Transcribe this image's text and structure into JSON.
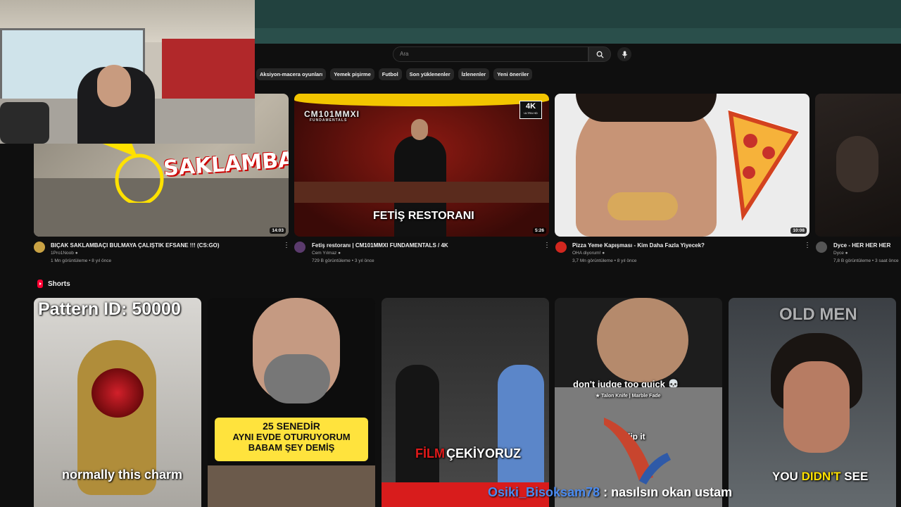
{
  "search": {
    "placeholder": "Ara"
  },
  "icons": {
    "search": "search-icon",
    "mic": "microphone-icon",
    "verified": "verified-icon",
    "kebab": "more-vert-icon",
    "shorts": "shorts-icon"
  },
  "chips": [
    "Aksiyon-macera oyunları",
    "Yemek pişirme",
    "Futbol",
    "Son yüklenenler",
    "İzlenenler",
    "Yeni öneriler"
  ],
  "videos": [
    {
      "title": "BIÇAK SAKLAMBAÇI BULMAYA ÇALIŞTIK EFSANE !!! (CS:GO)",
      "channel": "1Pro1Noob",
      "meta": "1 Mn görüntüleme • 8 yıl önce",
      "duration": "14:03",
      "overlay": "SAKLAMBAÇ"
    },
    {
      "title": "Fetiş restoranı | CM101MMXI FUNDAMENTALS / 4K",
      "channel": "Cem Yılmaz",
      "meta": "729 B görüntüleme • 3 yıl önce",
      "duration": "5:26",
      "overlay": "FETİŞ RESTORANI",
      "brand": "CM101MMXI",
      "brand_sub": "FUNDAMENTALS",
      "badge": "4K",
      "badge_sub": "ULTRA HD"
    },
    {
      "title": "Pizza Yeme Kapışması - Kim Daha Fazla Yiyecek?",
      "channel": "OHA diyorum!",
      "meta": "3,7 Mn görüntüleme • 8 yıl önce",
      "duration": "10:08"
    },
    {
      "title": "Dyce - HER HER HER",
      "channel": "Dyce",
      "meta": "7,8 B görüntüleme • 3 saat önce"
    }
  ],
  "shorts_title": "Shorts",
  "shorts": [
    {
      "top": "Pattern ID: 50000",
      "bottom": "normally this charm"
    },
    {
      "line1": "25 SENEDİR",
      "line2": "AYNI EVDE OTURUYORUM",
      "line3": "BABAM ŞEY DEMİŞ"
    },
    {
      "word1": "FİLM",
      "word2": "ÇEKİYORUZ"
    },
    {
      "caption": "don't judge too quick 💀",
      "sub": "★ Talon Knife | Marble Fade",
      "mid": "flip it"
    },
    {
      "top": "OLD MEN",
      "bottom1": "YOU",
      "bottom2": "DIDN'T",
      "bottom3": "SEE"
    }
  ],
  "chat": {
    "user": "Osiki_Bisoksam78",
    "message": " : nasılsın okan ustam"
  },
  "colors": {
    "bg": "#0f0f0f",
    "chip": "#272727",
    "topband": "#22423f",
    "shorts_red": "#ff0033",
    "chat_user": "#4b8bf0",
    "highlight_yellow": "#ffe100"
  }
}
